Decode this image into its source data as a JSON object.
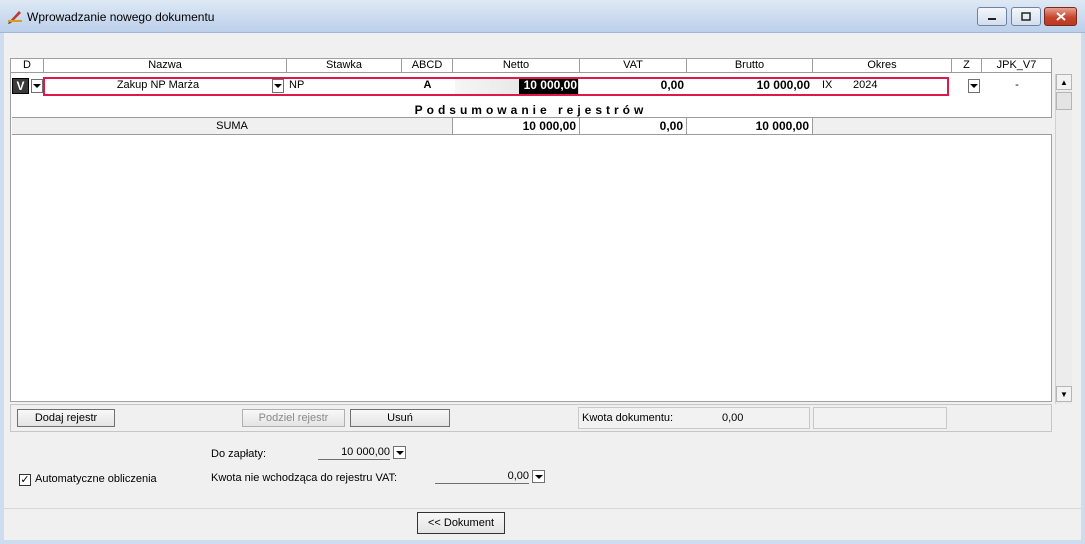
{
  "window": {
    "title": "Wprowadzanie nowego dokumentu"
  },
  "columns": [
    "D",
    "Nazwa",
    "Stawka",
    "ABCD",
    "Netto",
    "VAT",
    "Brutto",
    "Okres",
    "Z",
    "JPK_V7"
  ],
  "row": {
    "d": "V",
    "nazwa": "Zakup NP Marża",
    "stawka": "NP",
    "abcd": "A",
    "netto": "10 000,00",
    "vat": "0,00",
    "brutto": "10 000,00",
    "okres_month": "IX",
    "okres_year": "2024",
    "jpk": "-"
  },
  "summary": {
    "title": "Podsumowanie rejestrów",
    "label": "SUMA",
    "netto": "10 000,00",
    "vat": "0,00",
    "brutto": "10 000,00"
  },
  "toolbar": {
    "add_label": "Dodaj rejestr",
    "split_label": "Podziel rejestr",
    "remove_label": "Usuń",
    "amount_label": "Kwota dokumentu:",
    "amount_value": "0,00"
  },
  "form": {
    "to_pay_label": "Do zapłaty:",
    "to_pay_value": "10 000,00",
    "non_vat_label": "Kwota nie wchodząca do rejestru VAT:",
    "non_vat_value": "0,00",
    "auto_calc_label": "Automatyczne obliczenia",
    "auto_calc_checked": true,
    "document_button": "<< Dokument"
  },
  "colors": {
    "highlight": "#e0184a",
    "selection": "#000000"
  }
}
